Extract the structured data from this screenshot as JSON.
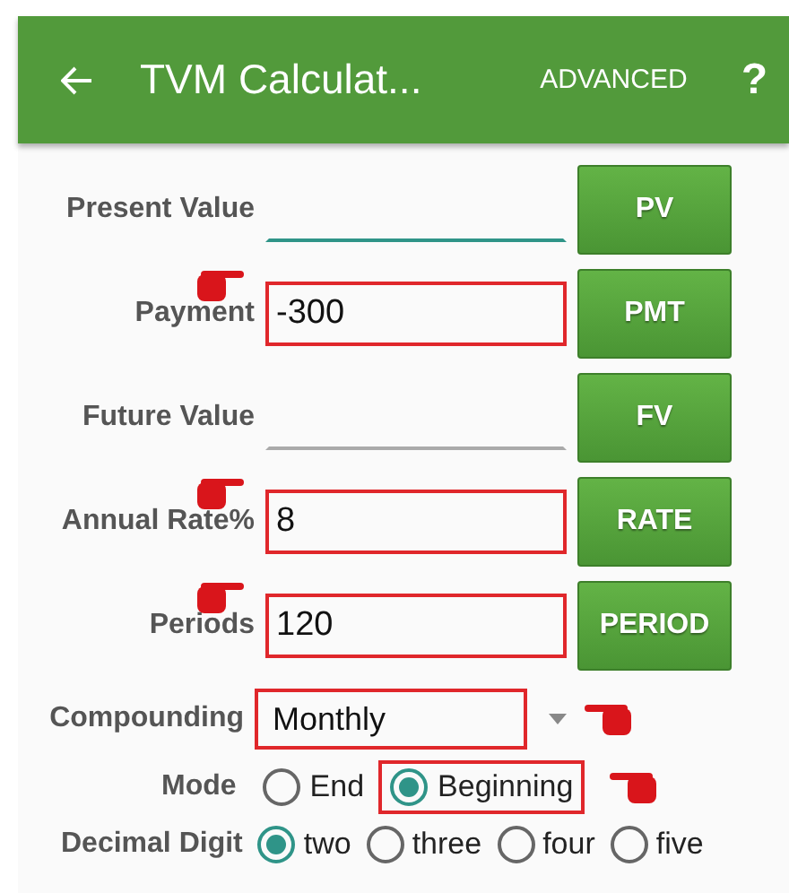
{
  "app_bar": {
    "title": "TVM Calculat...",
    "action": "ADVANCED",
    "help": "?"
  },
  "rows": [
    {
      "label": "Present Value",
      "value": "",
      "focused": true,
      "highlighted": false,
      "pointer": false,
      "button": "PV"
    },
    {
      "label": "Payment",
      "value": "-300",
      "focused": false,
      "highlighted": true,
      "pointer": true,
      "button": "PMT"
    },
    {
      "label": "Future Value",
      "value": "",
      "focused": false,
      "highlighted": false,
      "pointer": false,
      "button": "FV"
    },
    {
      "label": "Annual Rate%",
      "value": "8",
      "focused": false,
      "highlighted": true,
      "pointer": true,
      "button": "RATE"
    },
    {
      "label": "Periods",
      "value": "120",
      "focused": false,
      "highlighted": true,
      "pointer": true,
      "button": "PERIOD"
    }
  ],
  "compounding": {
    "label": "Compounding",
    "value": "Monthly",
    "highlighted": true,
    "pointer": true
  },
  "mode": {
    "label": "Mode",
    "pointer": true,
    "options": [
      {
        "label": "End",
        "selected": false,
        "highlighted": false
      },
      {
        "label": "Beginning",
        "selected": true,
        "highlighted": true
      }
    ]
  },
  "decimal_digit": {
    "label": "Decimal Digit",
    "options": [
      {
        "label": "two",
        "selected": true
      },
      {
        "label": "three",
        "selected": false
      },
      {
        "label": "four",
        "selected": false
      },
      {
        "label": "five",
        "selected": false
      }
    ]
  }
}
